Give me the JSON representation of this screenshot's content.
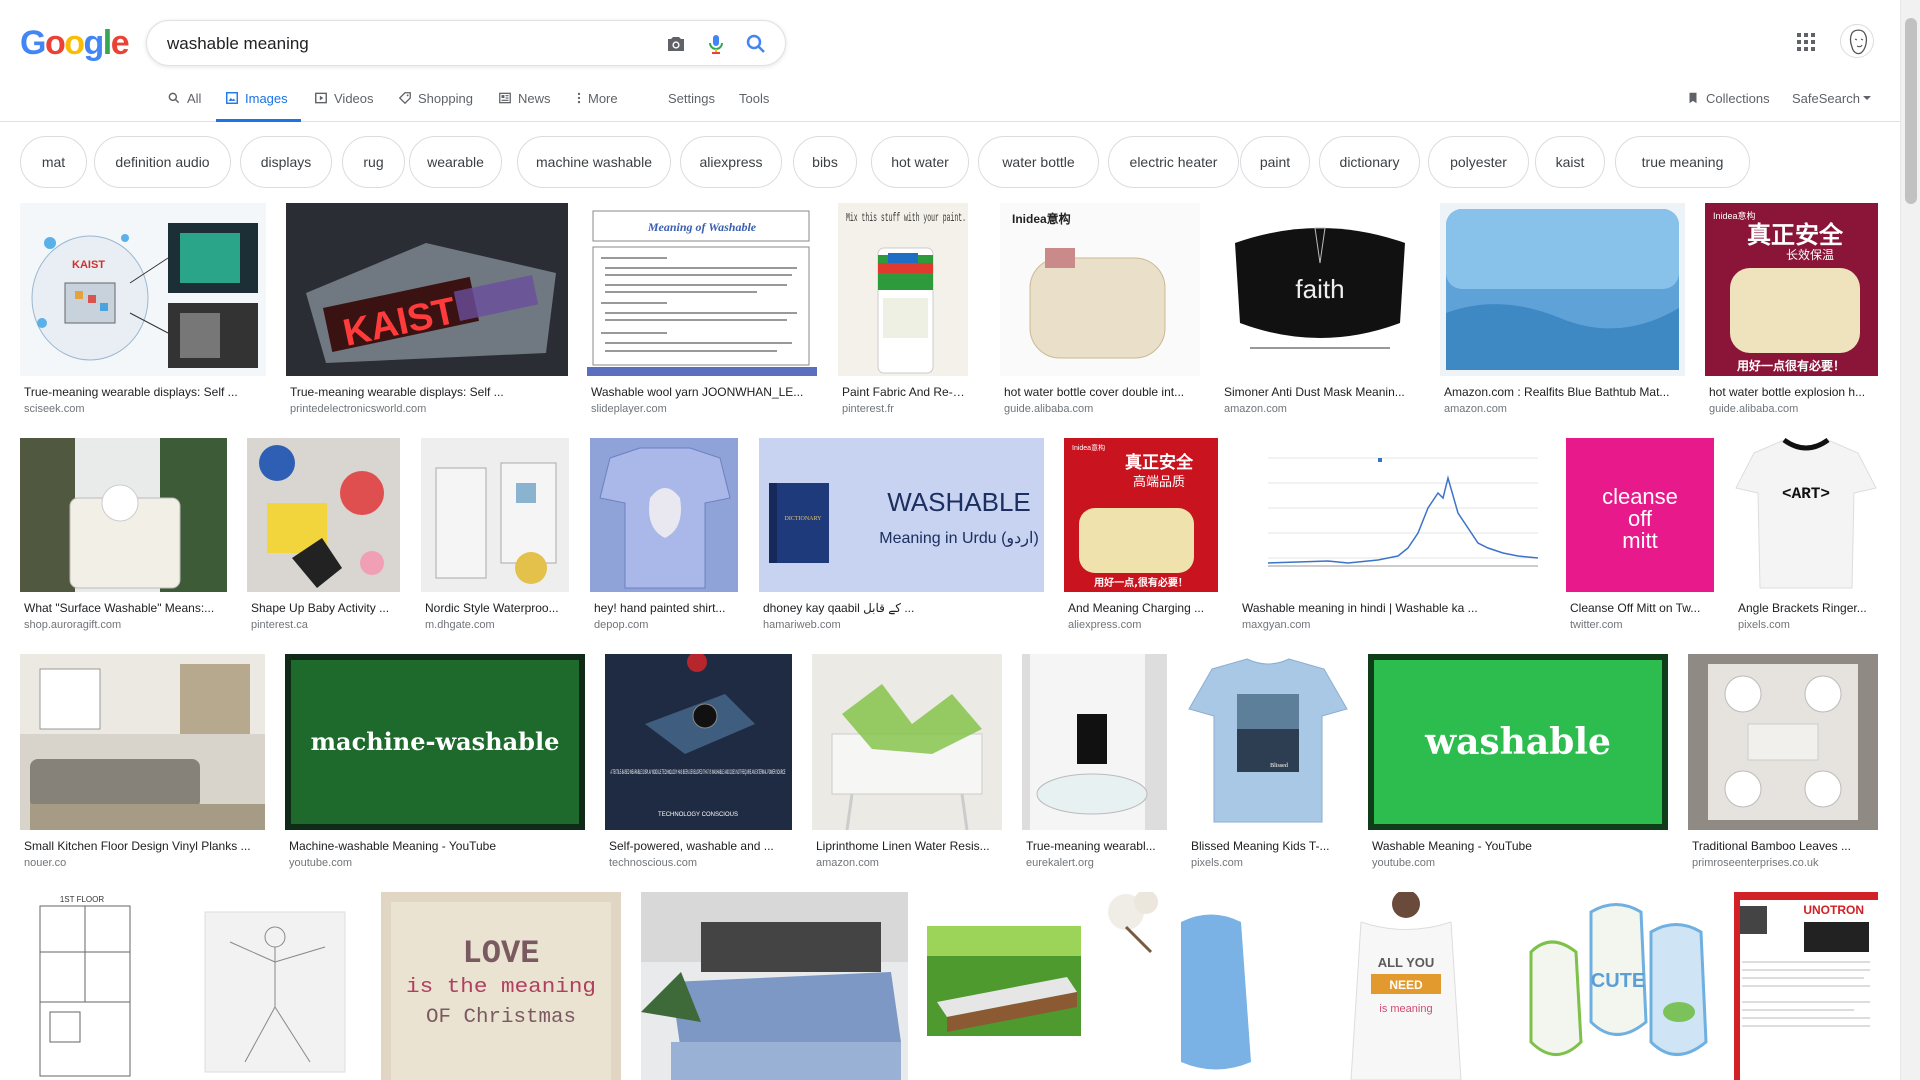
{
  "search": {
    "query": "washable meaning"
  },
  "logo": {
    "letters": [
      "G",
      "o",
      "o",
      "g",
      "l",
      "e"
    ]
  },
  "tabs": {
    "all": "All",
    "images": "Images",
    "videos": "Videos",
    "shopping": "Shopping",
    "news": "News",
    "more": "More",
    "settings": "Settings",
    "tools": "Tools"
  },
  "header_right": {
    "collections": "Collections",
    "safesearch": "SafeSearch"
  },
  "chips": [
    "mat",
    "definition audio",
    "displays",
    "rug",
    "wearable",
    "machine washable",
    "aliexpress",
    "bibs",
    "hot water",
    "water bottle",
    "electric heater",
    "paint",
    "dictionary",
    "polyester",
    "kaist",
    "true meaning"
  ],
  "rows": [
    [
      {
        "caption": "True-meaning wearable displays: Self ...",
        "source": "sciseek.com"
      },
      {
        "caption": "True-meaning wearable displays: Self ...",
        "source": "printedelectronicsworld.com"
      },
      {
        "caption": "Washable wool yarn JOONWHAN_LE...",
        "source": "slideplayer.com"
      },
      {
        "caption": "Paint Fabric And Re-u...",
        "source": "pinterest.fr"
      },
      {
        "caption": "hot water bottle cover double int...",
        "source": "guide.alibaba.com"
      },
      {
        "caption": "Simoner Anti Dust Mask Meanin...",
        "source": "amazon.com"
      },
      {
        "caption": "Amazon.com : Realfits Blue Bathtub Mat...",
        "source": "amazon.com"
      },
      {
        "caption": "hot water bottle explosion h...",
        "source": "guide.alibaba.com"
      }
    ],
    [
      {
        "caption": "What \"Surface Washable\" Means:...",
        "source": "shop.auroragift.com"
      },
      {
        "caption": "Shape Up Baby Activity ...",
        "source": "pinterest.ca"
      },
      {
        "caption": "Nordic Style Waterproo...",
        "source": "m.dhgate.com"
      },
      {
        "caption": "hey! hand painted shirt...",
        "source": "depop.com"
      },
      {
        "caption": "dhoney kay qaabil کے قابل ...",
        "source": "hamariweb.com"
      },
      {
        "caption": "And Meaning Charging ...",
        "source": "aliexpress.com"
      },
      {
        "caption": "Washable meaning in hindi | Washable ka ...",
        "source": "maxgyan.com"
      },
      {
        "caption": "Cleanse Off Mitt on Tw...",
        "source": "twitter.com"
      },
      {
        "caption": "Angle Brackets Ringer...",
        "source": "pixels.com"
      }
    ],
    [
      {
        "caption": "Small Kitchen Floor Design Vinyl Planks ...",
        "source": "nouer.co"
      },
      {
        "caption": "Machine-washable Meaning - YouTube",
        "source": "youtube.com"
      },
      {
        "caption": "Self-powered, washable and ...",
        "source": "technoscious.com"
      },
      {
        "caption": "Liprinthome Linen Water Resis...",
        "source": "amazon.com"
      },
      {
        "caption": "True-meaning wearabl...",
        "source": "eurekalert.org"
      },
      {
        "caption": "Blissed Meaning Kids T-...",
        "source": "pixels.com"
      },
      {
        "caption": "Washable Meaning - YouTube",
        "source": "youtube.com"
      },
      {
        "caption": "Traditional Bamboo Leaves ...",
        "source": "primroseenterprises.co.uk"
      }
    ]
  ],
  "thumb_text": {
    "kaist_label": "KAIST",
    "slide_title": "Meaning of Washable",
    "paint_text": "Mix this stuff with your paint.",
    "inidea": "Inidea意构",
    "faith": "faith",
    "cn_title": "真正安全",
    "cn_sub": "长效保温",
    "cn_footer": "用好一点很有必要！",
    "washable_word": "WASHABLE",
    "urdu_line": "Meaning in Urdu (اردو)",
    "dictionary": "DICTIONARY",
    "cn_title2": "真正安全",
    "cn_sub2": "高端品质",
    "cn_footer2": "用好一点,很有必要！",
    "cleanse1": "cleanse",
    "cleanse2": "off",
    "cleanse3": "mitt",
    "art": "<ART>",
    "machine_washable": "machine-washable",
    "washable": "washable",
    "tech_text": "A TEXTILE-BASED WEARABLE DISPLAY MODULE TECHNOLOGY HAS BEEN DEVELOPED THAT IS WASHABLE AND DOES NOT REQUIRE AN EXTERNAL POWER SOURCE",
    "tech_brand": "TECHNOLOGY CONSCIOUS",
    "blissed": "Blissed",
    "floor": "1ST FLOOR",
    "love1": "LOVE",
    "love2": "is the meaning",
    "love3": "OF Christmas",
    "all_you": "ALL YOU",
    "need": "NEED",
    "is_meaning": "is meaning",
    "cute": "CUTE",
    "unotron": "UNOTRON"
  },
  "colors": {
    "accent": "#1a73e8",
    "border": "#dadce0",
    "text_secondary": "#70757a"
  }
}
